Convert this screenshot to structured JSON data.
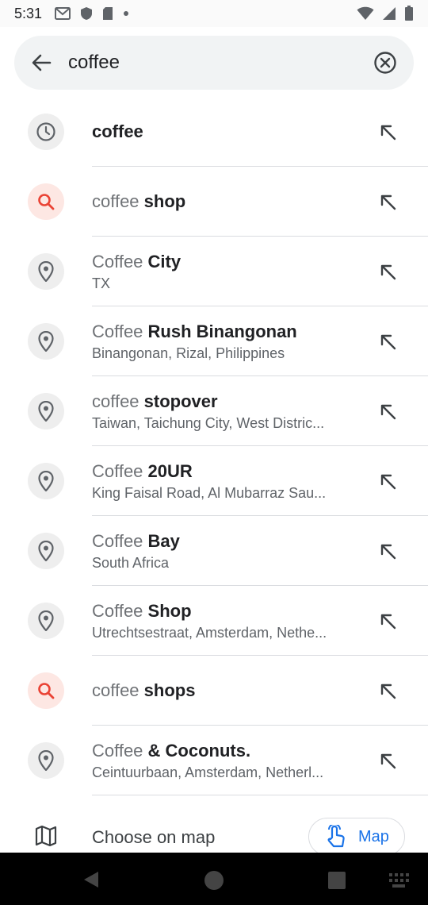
{
  "status_bar": {
    "time": "5:31"
  },
  "search": {
    "query": "coffee"
  },
  "suggestions": [
    {
      "type": "history",
      "icon": "clock-icon",
      "title_match": "",
      "title_rest": "coffee",
      "subtitle": ""
    },
    {
      "type": "search",
      "icon": "search-icon",
      "title_match": "coffee",
      "title_rest": " shop",
      "subtitle": ""
    },
    {
      "type": "place",
      "icon": "pin-icon",
      "title_match": "Coffee",
      "title_rest": " City",
      "subtitle": "TX"
    },
    {
      "type": "place",
      "icon": "pin-icon",
      "title_match": "Coffee",
      "title_rest": " Rush Binangonan",
      "subtitle": "Binangonan, Rizal, Philippines"
    },
    {
      "type": "place",
      "icon": "pin-icon",
      "title_match": "coffee",
      "title_rest": " stopover",
      "subtitle": "Taiwan, Taichung City, West Distric..."
    },
    {
      "type": "place",
      "icon": "pin-icon",
      "title_match": "Coffee",
      "title_rest": " 20UR",
      "subtitle": "King Faisal Road, Al Mubarraz Sau..."
    },
    {
      "type": "place",
      "icon": "pin-icon",
      "title_match": "Coffee",
      "title_rest": " Bay",
      "subtitle": "South Africa"
    },
    {
      "type": "place",
      "icon": "pin-icon",
      "title_match": "Coffee",
      "title_rest": " Shop",
      "subtitle": "Utrechtsestraat, Amsterdam, Nethe..."
    },
    {
      "type": "search",
      "icon": "search-icon",
      "title_match": "coffee",
      "title_rest": " shops",
      "subtitle": ""
    },
    {
      "type": "place",
      "icon": "pin-icon",
      "title_match": "Coffee",
      "title_rest": " & Coconuts.",
      "subtitle": "Ceintuurbaan, Amsterdam, Netherl..."
    }
  ],
  "footer": {
    "choose_on_map": "Choose on map",
    "map_button": "Map"
  },
  "colors": {
    "accent": "#1a73e8",
    "search_red": "#ea4335",
    "icon_grey": "#5f6368"
  }
}
